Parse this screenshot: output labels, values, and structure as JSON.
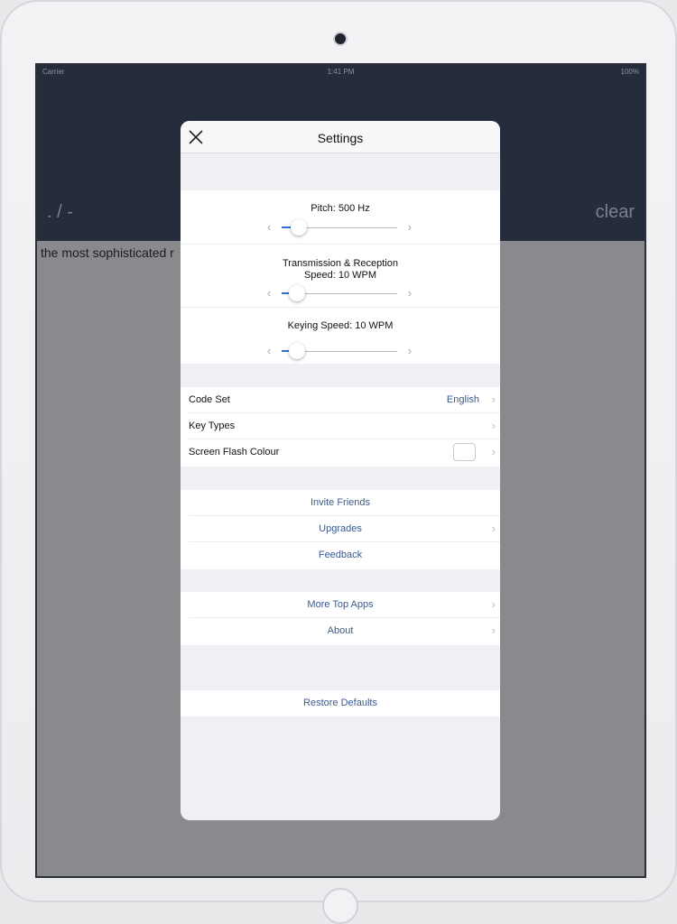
{
  "status_bar": {
    "carrier": "Carrier",
    "time": "1:41 PM",
    "battery": "100%"
  },
  "app": {
    "morse_symbols": ". / -",
    "clear_label": "clear",
    "text": "the most sophisticated r"
  },
  "modal": {
    "title": "Settings",
    "close_icon": "close-icon",
    "sliders": [
      {
        "label": "Pitch: 500 Hz",
        "value_fraction": 0.15
      },
      {
        "label": "Transmission & Reception Speed: 10 WPM",
        "label_line1": "Transmission & Reception",
        "label_line2": "Speed: 10 WPM",
        "value_fraction": 0.13
      },
      {
        "label": "Keying Speed: 10 WPM",
        "value_fraction": 0.13
      }
    ],
    "options": [
      {
        "label": "Code Set",
        "value": "English"
      },
      {
        "label": "Key Types",
        "value": ""
      },
      {
        "label": "Screen Flash Colour",
        "swatch": "#ffffff"
      }
    ],
    "social": [
      {
        "label": "Invite Friends"
      },
      {
        "label": "Upgrades"
      },
      {
        "label": "Feedback"
      }
    ],
    "more": [
      {
        "label": "More Top Apps"
      },
      {
        "label": "About"
      }
    ],
    "restore_label": "Restore Defaults"
  },
  "colors": {
    "accent": "#2f6fd8",
    "link": "#3b5a8f",
    "header": "#252d3d"
  }
}
